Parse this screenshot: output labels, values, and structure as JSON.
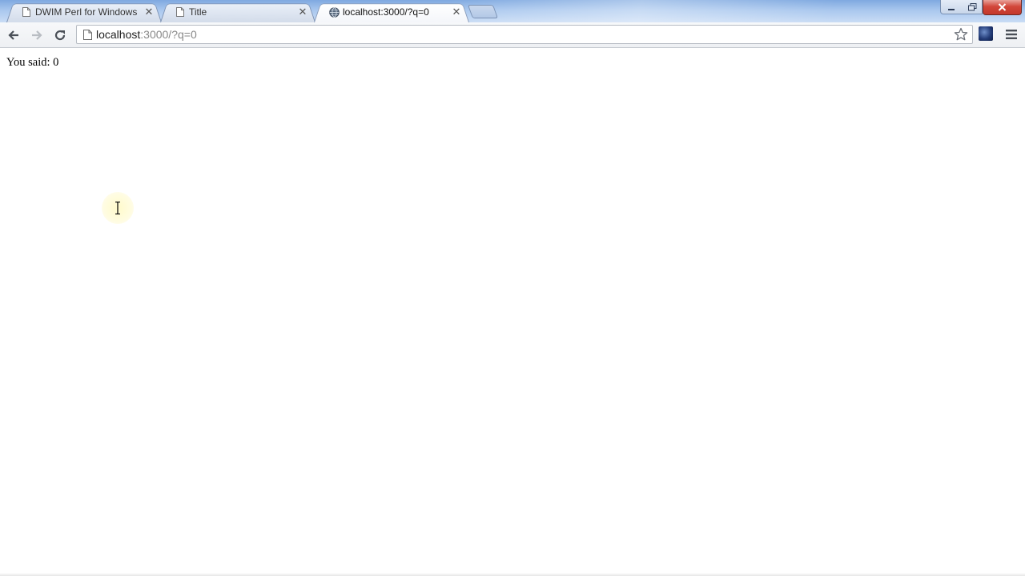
{
  "tabs": [
    {
      "title": "DWIM Perl for Windows",
      "active": false
    },
    {
      "title": "Title",
      "active": false
    },
    {
      "title": "localhost:3000/?q=0",
      "active": true
    }
  ],
  "toolbar": {
    "url_host": "localhost",
    "url_rest": ":3000/?q=0"
  },
  "page": {
    "text": "You said: 0"
  },
  "icons": {
    "back": "back-arrow-icon",
    "forward": "forward-arrow-icon",
    "reload": "reload-icon",
    "page": "page-icon",
    "star": "star-icon",
    "extension": "extension-icon",
    "menu": "hamburger-menu-icon"
  },
  "colors": {
    "tabstrip": "#a9c7ee",
    "close_button": "#d2473a"
  }
}
